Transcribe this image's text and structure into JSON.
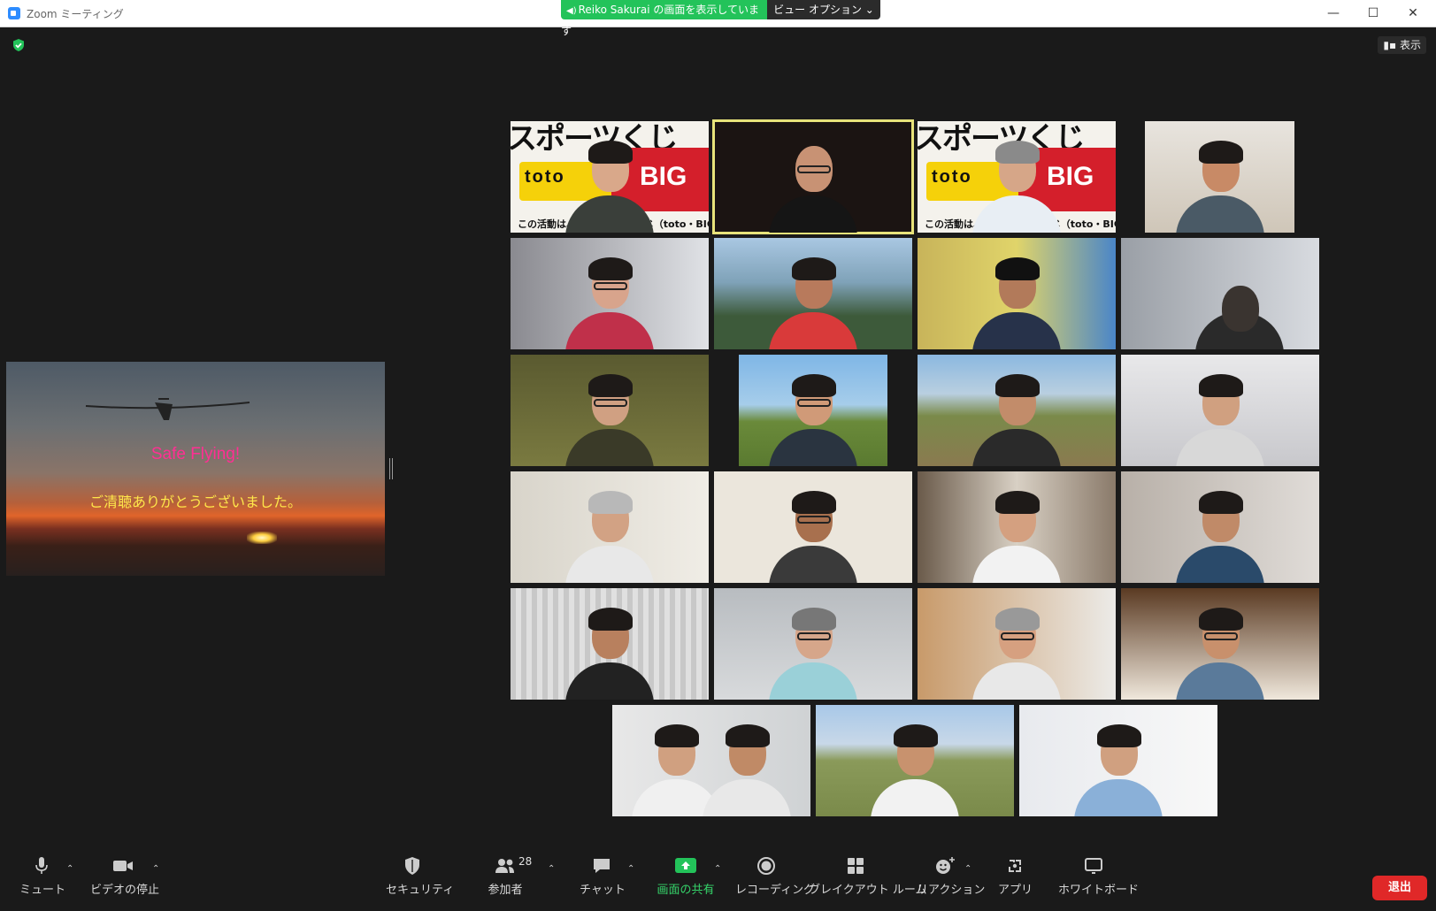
{
  "window": {
    "title": "Zoom ミーティング",
    "sharing_banner": "Reiko  Sakurai の画面を表示しています",
    "view_options": "ビュー オプション ⌄",
    "view_toggle": "表示"
  },
  "shared_screen": {
    "headline": "Safe Flying!",
    "message": "ご清聴ありがとうございました。"
  },
  "gallery": {
    "poster_text": {
      "title": "スポーツくじ",
      "toto": "toto",
      "big": "BIG",
      "caption_left": "この活動は、スポーツ振興くじ（toto・BIG）の",
      "caption_right": "この活動は、スポーツ振興くじ（toto・BIG）の"
    }
  },
  "toolbar": {
    "mute": "ミュート",
    "stop_video": "ビデオの停止",
    "security": "セキュリティ",
    "participants": "参加者",
    "participants_count": "28",
    "chat": "チャット",
    "share_screen": "画面の共有",
    "recording": "レコーディング",
    "breakout": "ブレイクアウト ルーム",
    "reactions": "リアクション",
    "apps": "アプリ",
    "whiteboard": "ホワイトボード",
    "leave": "退出"
  },
  "colors": {
    "background": "#1a1a1a",
    "share_banner": "#23c35a",
    "share_button": "#23c35a",
    "leave_button": "#e02828",
    "active_speaker_border": "#e8e37a",
    "headline": "#ff2f93",
    "message": "#ffe74a"
  }
}
